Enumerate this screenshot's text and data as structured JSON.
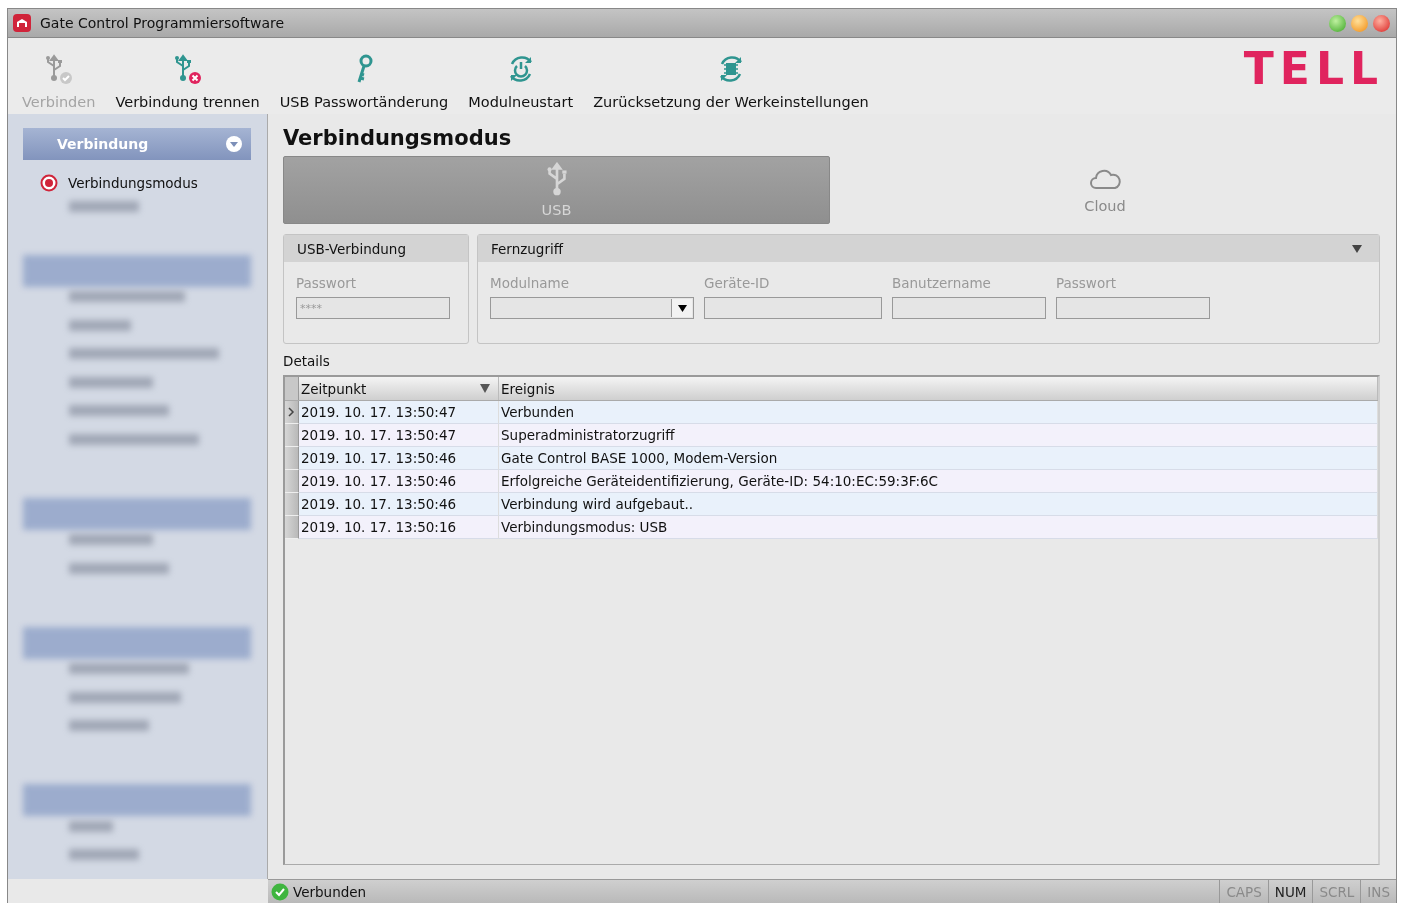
{
  "window": {
    "title": "Gate Control Programmiersoftware"
  },
  "toolbar": [
    {
      "kind": "connect",
      "label": "Verbinden",
      "disabled": true
    },
    {
      "kind": "disconnect",
      "label": "Verbindung trennen",
      "disabled": false
    },
    {
      "kind": "key",
      "label": "USB Passwortänderung",
      "disabled": false
    },
    {
      "kind": "restart",
      "label": "Modulneustart",
      "disabled": false
    },
    {
      "kind": "reset",
      "label": "Zurücksetzung der Werkeinstellungen",
      "disabled": false
    }
  ],
  "logo": {
    "text": "TELL"
  },
  "sidebar": {
    "section": {
      "title": "Verbindung",
      "items": [
        {
          "label": "Verbindungsmodus",
          "selected": true
        }
      ]
    },
    "blurred_sections": [
      {
        "items": [
          {
            "kind": "blurred"
          }
        ]
      },
      {
        "items": [
          {
            "kind": "blurred"
          },
          {
            "kind": "blurred"
          },
          {
            "kind": "blurred"
          },
          {
            "kind": "blurred"
          },
          {
            "kind": "blurred"
          },
          {
            "kind": "blurred"
          }
        ]
      },
      {
        "items": [
          {
            "kind": "blurred"
          },
          {
            "kind": "blurred"
          }
        ]
      },
      {
        "items": [
          {
            "kind": "blurred"
          },
          {
            "kind": "blurred"
          },
          {
            "kind": "blurred"
          }
        ]
      },
      {
        "items": [
          {
            "kind": "blurred"
          },
          {
            "kind": "blurred"
          }
        ]
      }
    ]
  },
  "page_title": "Verbindungsmodus",
  "modes": [
    {
      "kind": "usb",
      "label": "USB",
      "selected": true
    },
    {
      "kind": "cloud",
      "label": "Cloud",
      "selected": false
    }
  ],
  "usb_panel": {
    "title": "USB-Verbindung",
    "fields": [
      {
        "label": "Passwort",
        "value": "****"
      }
    ]
  },
  "remote_panel": {
    "title": "Fernzugriff",
    "fields": [
      {
        "label": "Modulname",
        "kind": "dropdown"
      },
      {
        "label": "Geräte-ID",
        "kind": "text"
      },
      {
        "label": "Banutzername",
        "kind": "text"
      },
      {
        "label": "Passwort",
        "kind": "text"
      }
    ]
  },
  "details": {
    "title": "Details",
    "columns": [
      "Zeitpunkt",
      "Ereignis"
    ],
    "rows": [
      {
        "time": "2019. 10. 17. 13:50:47",
        "event": "Verbunden",
        "selected": true
      },
      {
        "time": "2019. 10. 17. 13:50:47",
        "event": "Superadministratorzugriff",
        "selected": false
      },
      {
        "time": "2019. 10. 17. 13:50:46",
        "event": "Gate Control BASE 1000, Modem-Version",
        "selected": false
      },
      {
        "time": "2019. 10. 17. 13:50:46",
        "event": "Erfolgreiche Geräteidentifizierung, Geräte-ID: 54:10:EC:59:3F:6C",
        "selected": false
      },
      {
        "time": "2019. 10. 17. 13:50:46",
        "event": "Verbindung wird aufgebaut..",
        "selected": false
      },
      {
        "time": "2019. 10. 17. 13:50:16",
        "event": "Verbindungsmodus: USB",
        "selected": false
      }
    ]
  },
  "status_bar": {
    "text": "Verbunden",
    "indicators": [
      {
        "label": "CAPS",
        "on": false
      },
      {
        "label": "NUM",
        "on": true
      },
      {
        "label": "SCRL",
        "on": false
      },
      {
        "label": "INS",
        "on": false
      }
    ]
  }
}
